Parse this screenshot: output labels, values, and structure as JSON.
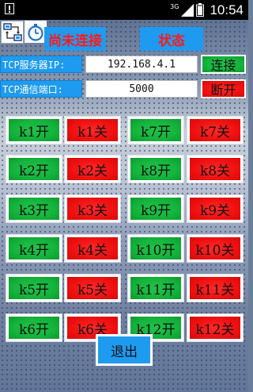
{
  "status_bar": {
    "network": "3G",
    "time": "10:54"
  },
  "header": {
    "connection_status": "尚未连接",
    "state_label": "状态",
    "icons": [
      "network-switch-icon",
      "stopwatch-icon"
    ]
  },
  "connection": {
    "ip_label": "TCP服务器IP:",
    "ip_value": "192.168.4.1",
    "port_label": "TCP通信端口:",
    "port_value": "5000",
    "connect_label": "连接",
    "disconnect_label": "断开"
  },
  "relays": [
    {
      "on": "k1开",
      "off": "k1关"
    },
    {
      "on": "k2开",
      "off": "k2关"
    },
    {
      "on": "k3开",
      "off": "k3关"
    },
    {
      "on": "k4开",
      "off": "k4关"
    },
    {
      "on": "k5开",
      "off": "k5关"
    },
    {
      "on": "k6开",
      "off": "k6关"
    },
    {
      "on": "k7开",
      "off": "k7关"
    },
    {
      "on": "k8开",
      "off": "k8关"
    },
    {
      "on": "k9开",
      "off": "k9关"
    },
    {
      "on": "k10开",
      "off": "k10关"
    },
    {
      "on": "k11开",
      "off": "k11关"
    },
    {
      "on": "k12开",
      "off": "k12关"
    }
  ],
  "footer": {
    "exit_label": "退出"
  },
  "colors": {
    "on_button": "#13b33c",
    "off_button": "#f01010",
    "title_bg": "#1e9bf0",
    "title_text": "#ff1a1a"
  }
}
